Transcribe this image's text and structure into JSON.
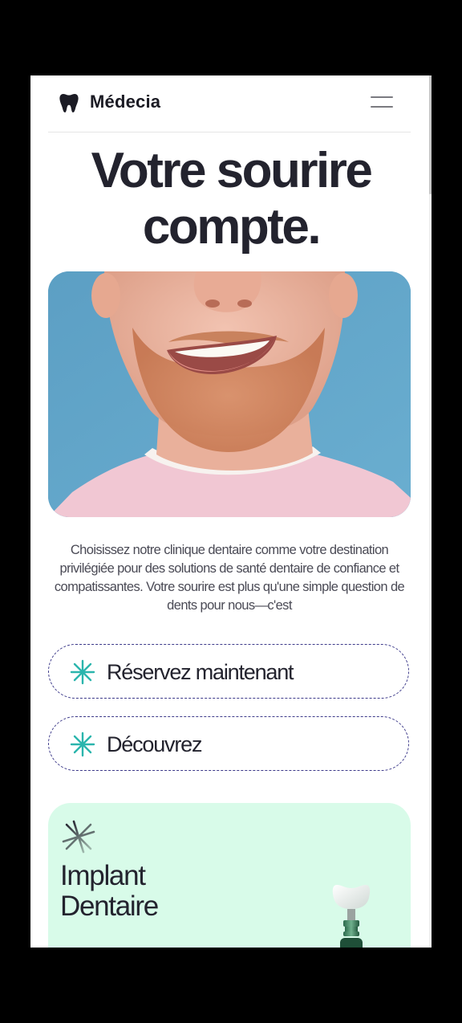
{
  "header": {
    "brand": "Médecia",
    "logo_icon": "tooth-icon",
    "menu_icon": "hamburger-menu-icon"
  },
  "hero": {
    "title_line1": "Votre sourire",
    "title_line2": "compte.",
    "image": "smiling-man-photo"
  },
  "intro": {
    "text": "Choisissez notre clinique dentaire comme votre destination privilégiée pour des solutions de santé dentaire de confiance et compatissantes. Votre sourire est plus qu'une simple question de dents pour nous—c'est"
  },
  "buttons": {
    "book_label": "Réservez maintenant",
    "discover_label": "Découvrez",
    "icon": "sparkle-star-icon"
  },
  "card": {
    "title_line1": "Implant",
    "title_line2": "Dentaire",
    "icon": "sparkle-star-icon",
    "image": "dental-implant-illustration"
  },
  "colors": {
    "text_dark": "#23232e",
    "accent_teal": "#2bb5ad",
    "dashed_border": "#3d3a8a",
    "card_background": "#d8fbe9",
    "photo_background": "#5fa2c6"
  }
}
